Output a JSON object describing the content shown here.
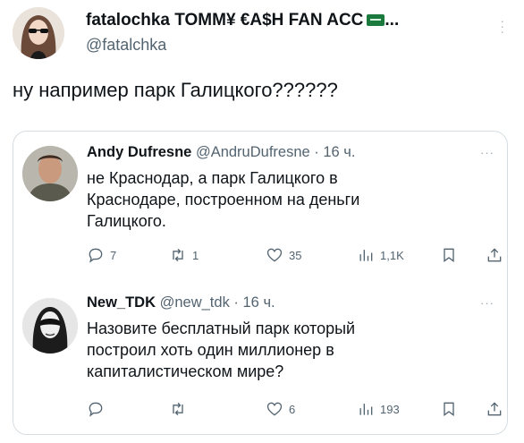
{
  "post": {
    "author_name": "fatalochka TOMM¥ €A$H FAN ACC",
    "author_suffix": "...",
    "handle": "@fatalchka",
    "text": "ну например парк Галицкого??????"
  },
  "replies": [
    {
      "name": "Andy Dufresne",
      "handle": "@AndruDufresne",
      "time": "· 16 ч.",
      "lines": [
        "не Краснодар, а парк Галицкого в",
        "Краснодаре, построенном на деньги",
        "Галицкого."
      ],
      "reply_count": "7",
      "retweet_count": "1",
      "like_count": "35",
      "views_count": "1,1K"
    },
    {
      "name": "New_TDK",
      "handle": "@new_tdk",
      "time": "· 16 ч.",
      "lines": [
        "Назовите бесплатный парк который",
        "построил хоть один миллионер в",
        "капиталистическом мире?"
      ],
      "reply_count": "",
      "retweet_count": "",
      "like_count": "6",
      "views_count": "193"
    }
  ],
  "colors": {
    "text": "#0f1419",
    "secondary": "#536471",
    "border": "#d6dde2",
    "flag": "#1b7a3e"
  }
}
